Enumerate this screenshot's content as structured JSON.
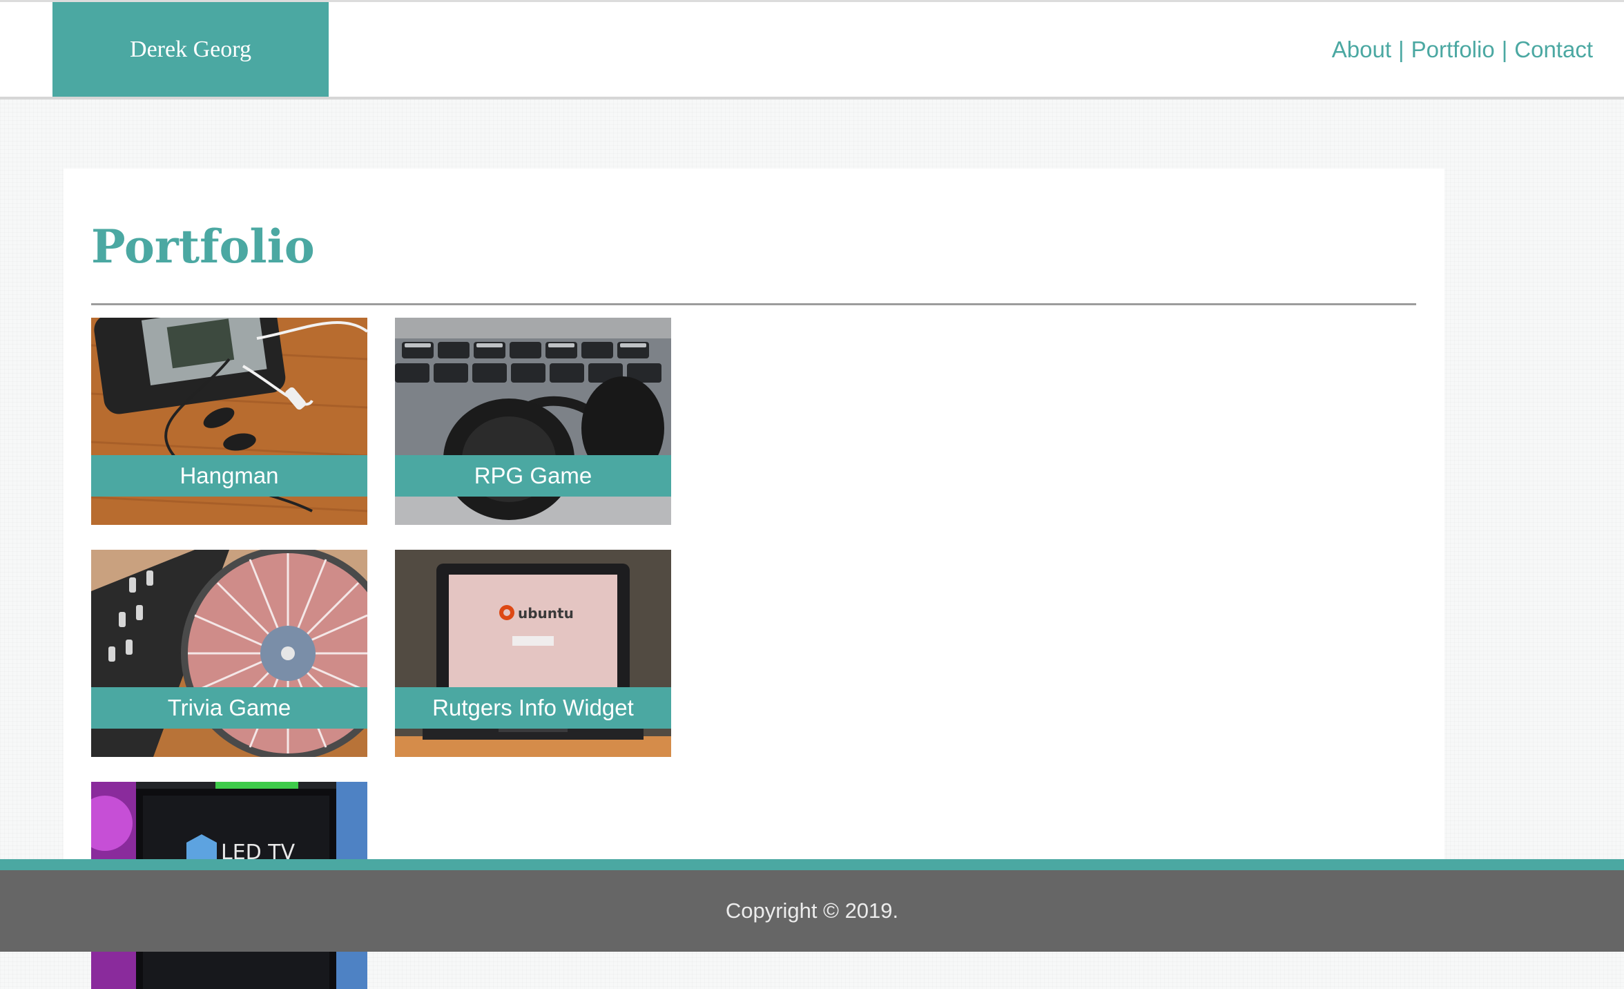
{
  "header": {
    "brand": "Derek Georg",
    "nav": [
      {
        "label": "About"
      },
      {
        "label": "Portfolio"
      },
      {
        "label": "Contact"
      }
    ],
    "separator": "|"
  },
  "main": {
    "title": "Portfolio",
    "projects": [
      {
        "label": "Hangman",
        "image": "earbuds and phone on wood table"
      },
      {
        "label": "RPG Game",
        "image": "headphones on keyboard"
      },
      {
        "label": "Trivia Game",
        "image": "dj turntable"
      },
      {
        "label": "Rutgers Info Widget",
        "image": "laptop showing ubuntu"
      },
      {
        "label": "",
        "image": "led tv display"
      }
    ],
    "photo_text": {
      "ubuntu": "ubuntu",
      "tv": "LED TV"
    }
  },
  "footer": {
    "copyright": "Copyright © 2019."
  },
  "colors": {
    "accent": "#4ba8a2",
    "footer": "#666666",
    "background": "#f7f8f8"
  }
}
